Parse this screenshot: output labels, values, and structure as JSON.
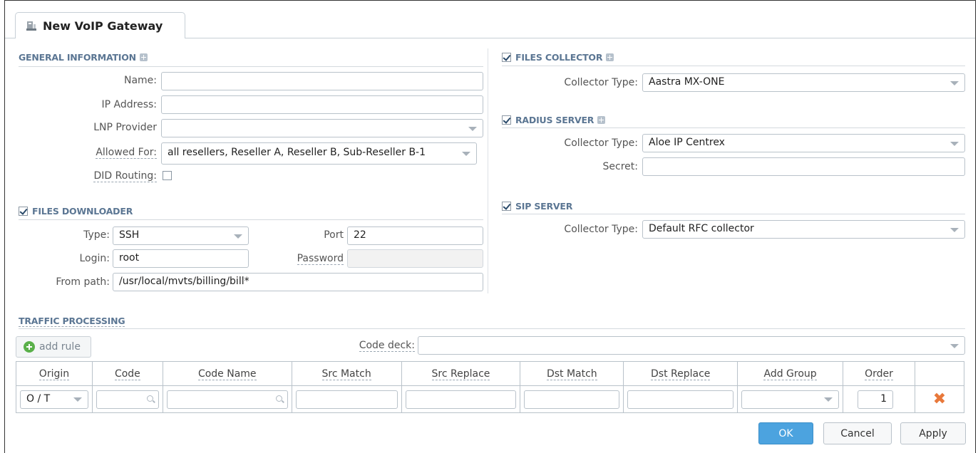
{
  "window": {
    "tab_title": "New VoIP Gateway"
  },
  "general": {
    "title": "GENERAL INFORMATION",
    "name_label": "Name:",
    "name_value": "",
    "ip_label": "IP Address:",
    "ip_value": "",
    "lnp_label": "LNP Provider",
    "lnp_value": "",
    "allowed_label": "Allowed For:",
    "allowed_value": "all resellers, Reseller A, Reseller B, Sub-Reseller B-1",
    "did_label": "DID Routing:",
    "did_checked": false
  },
  "downloader": {
    "title": "FILES DOWNLOADER",
    "enabled": true,
    "type_label": "Type:",
    "type_value": "SSH",
    "port_label": "Port",
    "port_value": "22",
    "login_label": "Login:",
    "login_value": "root",
    "password_label": "Password",
    "password_value": "",
    "path_label": "From path:",
    "path_value": "/usr/local/mvts/billing/bill*"
  },
  "collector": {
    "title": "FILES COLLECTOR",
    "enabled": true,
    "type_label": "Collector Type:",
    "type_value": "Aastra MX-ONE"
  },
  "radius": {
    "title": "RADIUS SERVER",
    "enabled": true,
    "type_label": "Collector Type:",
    "type_value": "Aloe IP Centrex",
    "secret_label": "Secret:",
    "secret_value": ""
  },
  "sip": {
    "title": "SIP SERVER",
    "enabled": true,
    "type_label": "Collector Type:",
    "type_value": "Default RFC collector"
  },
  "traffic": {
    "title": "TRAFFIC PROCESSING",
    "add_rule": "add rule",
    "code_deck_label": "Code deck:",
    "code_deck_value": "",
    "columns": [
      "Origin",
      "Code",
      "Code Name",
      "Src Match",
      "Src Replace",
      "Dst Match",
      "Dst Replace",
      "Add Group",
      "Order"
    ],
    "row": {
      "origin": "O / T",
      "order": "1"
    }
  },
  "buttons": {
    "ok": "OK",
    "cancel": "Cancel",
    "apply": "Apply"
  },
  "colors": {
    "accent": "#4ca3df",
    "section_title": "#5b7693",
    "delete": "#e8783a",
    "add": "#5ab04a"
  }
}
